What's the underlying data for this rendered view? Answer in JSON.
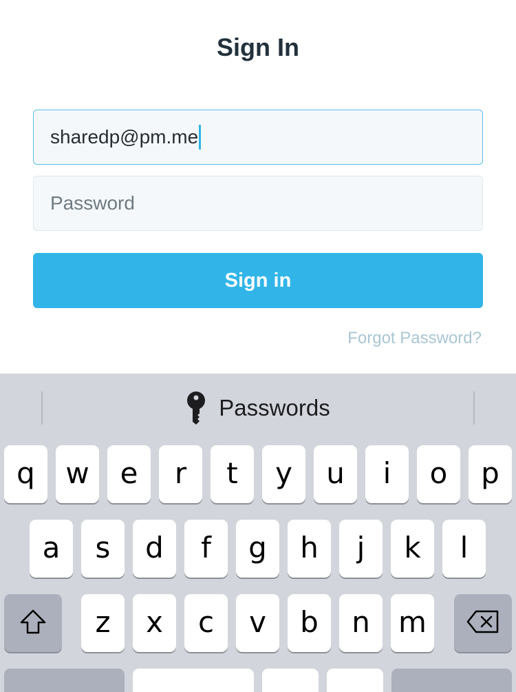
{
  "header": {
    "title": "Sign In"
  },
  "form": {
    "email_value": "sharedp@pm.me",
    "password_placeholder": "Password",
    "signin_label": "Sign in",
    "forgot_label": "Forgot Password?"
  },
  "colors": {
    "accent": "#31b5e8",
    "title": "#22313b",
    "link": "#a9c6d3",
    "keyboard_bg": "#d2d5db"
  },
  "keyboard": {
    "suggestion_label": "Passwords",
    "suggestion_icon": "key-icon",
    "row1": [
      "q",
      "w",
      "e",
      "r",
      "t",
      "y",
      "u",
      "i",
      "o",
      "p"
    ],
    "row2": [
      "a",
      "s",
      "d",
      "f",
      "g",
      "h",
      "j",
      "k",
      "l"
    ],
    "row3": [
      "z",
      "x",
      "c",
      "v",
      "b",
      "n",
      "m"
    ],
    "shift_icon": "shift-icon",
    "delete_icon": "backspace-icon"
  }
}
